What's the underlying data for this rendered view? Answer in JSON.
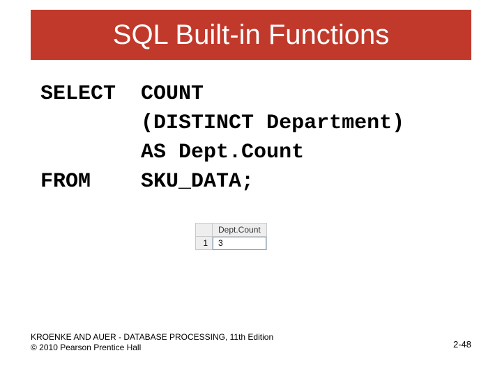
{
  "title": "SQL Built-in Functions",
  "code": {
    "line1a": "SELECT",
    "line1b": "COUNT",
    "line2": "(DISTINCT Department)",
    "line3": "AS Dept.Count",
    "line4a": "FROM",
    "line4b": "SKU_DATA;"
  },
  "result": {
    "header": "Dept.Count",
    "rownum": "1",
    "value": "3"
  },
  "footer": {
    "line1": "KROENKE AND AUER - DATABASE PROCESSING, 11th Edition",
    "line2": "© 2010 Pearson Prentice Hall",
    "page": "2-48"
  }
}
